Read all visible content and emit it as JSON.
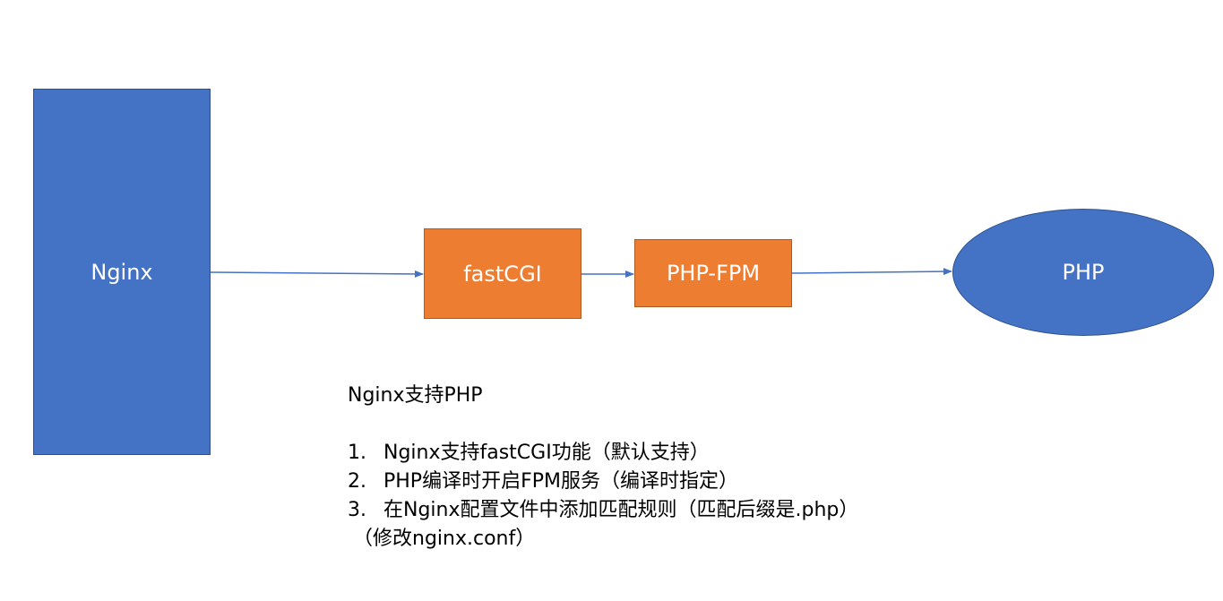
{
  "diagram": {
    "nodes": {
      "nginx": {
        "label": "Nginx",
        "shape": "rectangle",
        "color": "#4472c4"
      },
      "fastcgi": {
        "label": "fastCGI",
        "shape": "rectangle",
        "color": "#ed7d31"
      },
      "phpfpm": {
        "label": "PHP-FPM",
        "shape": "rectangle",
        "color": "#ed7d31"
      },
      "php": {
        "label": "PHP",
        "shape": "ellipse",
        "color": "#4472c4"
      }
    },
    "edges": [
      {
        "from": "nginx",
        "to": "fastcgi"
      },
      {
        "from": "fastcgi",
        "to": "phpfpm"
      },
      {
        "from": "phpfpm",
        "to": "php"
      }
    ],
    "edge_color": "#4472c4"
  },
  "notes": {
    "title": "Nginx支持PHP",
    "items": [
      {
        "num": "1.",
        "text": "Nginx支持fastCGI功能（默认支持）"
      },
      {
        "num": "2.",
        "text": "PHP编译时开启FPM服务（编译时指定）"
      },
      {
        "num": "3.",
        "text": "在Nginx配置文件中添加匹配规则（匹配后缀是.php）"
      }
    ],
    "continuation": "（修改nginx.conf）"
  }
}
